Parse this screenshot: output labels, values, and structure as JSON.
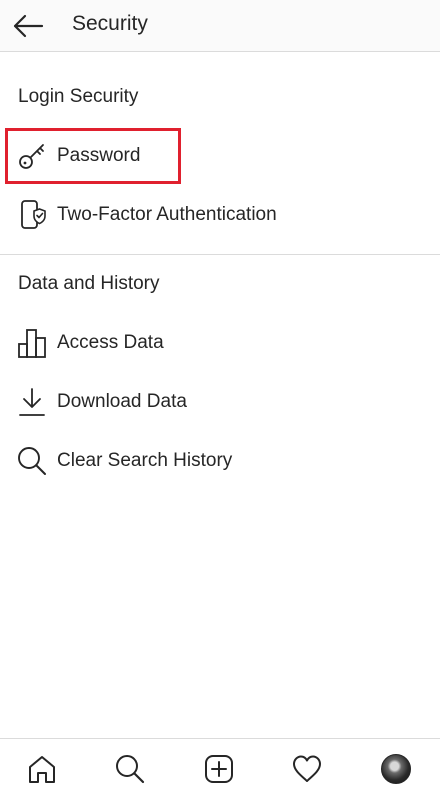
{
  "header": {
    "title": "Security",
    "back_icon": "back-arrow-icon"
  },
  "sections": [
    {
      "title": "Login Security",
      "items": [
        {
          "label": "Password",
          "icon": "key-icon",
          "highlighted": true
        },
        {
          "label": "Two-Factor Authentication",
          "icon": "phone-shield-icon"
        }
      ]
    },
    {
      "title": "Data and History",
      "items": [
        {
          "label": "Access Data",
          "icon": "bar-chart-icon"
        },
        {
          "label": "Download Data",
          "icon": "download-icon"
        },
        {
          "label": "Clear Search History",
          "icon": "search-icon"
        }
      ]
    }
  ],
  "bottom_nav": {
    "items": [
      {
        "icon": "home-icon"
      },
      {
        "icon": "search-icon"
      },
      {
        "icon": "new-post-icon"
      },
      {
        "icon": "heart-icon"
      },
      {
        "icon": "profile-avatar"
      }
    ]
  },
  "colors": {
    "highlight": "#e0202e",
    "text": "#262626",
    "divider": "#dbdbdb",
    "header_bg": "#fafafa"
  }
}
